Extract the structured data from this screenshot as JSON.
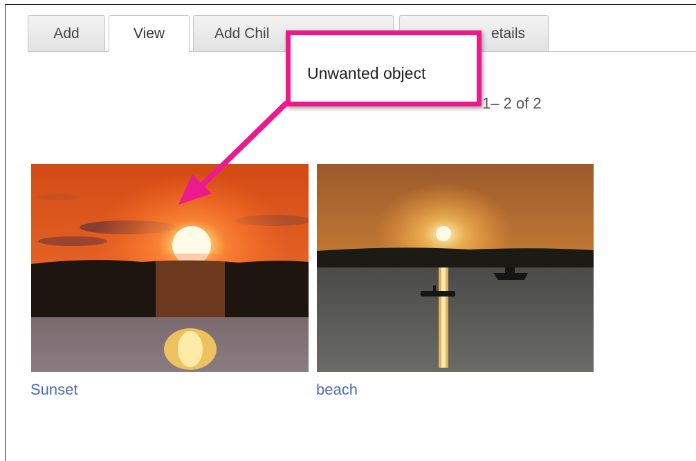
{
  "tabs": [
    {
      "label": "Add",
      "active": false
    },
    {
      "label": "View",
      "active": true
    },
    {
      "label": "Add Chil",
      "active": false
    },
    {
      "label": "etails",
      "active": false
    }
  ],
  "pager": {
    "text": "1– 2 of 2"
  },
  "items": [
    {
      "caption": "Sunset",
      "image": "sunset over water"
    },
    {
      "caption": "beach",
      "image": "sun setting over lake with boats"
    }
  ],
  "annotation": {
    "text": "Unwanted object",
    "color": "#ec1a8c"
  },
  "colors": {
    "link": "#4b6cb7",
    "accent": "#ec1a8c"
  }
}
